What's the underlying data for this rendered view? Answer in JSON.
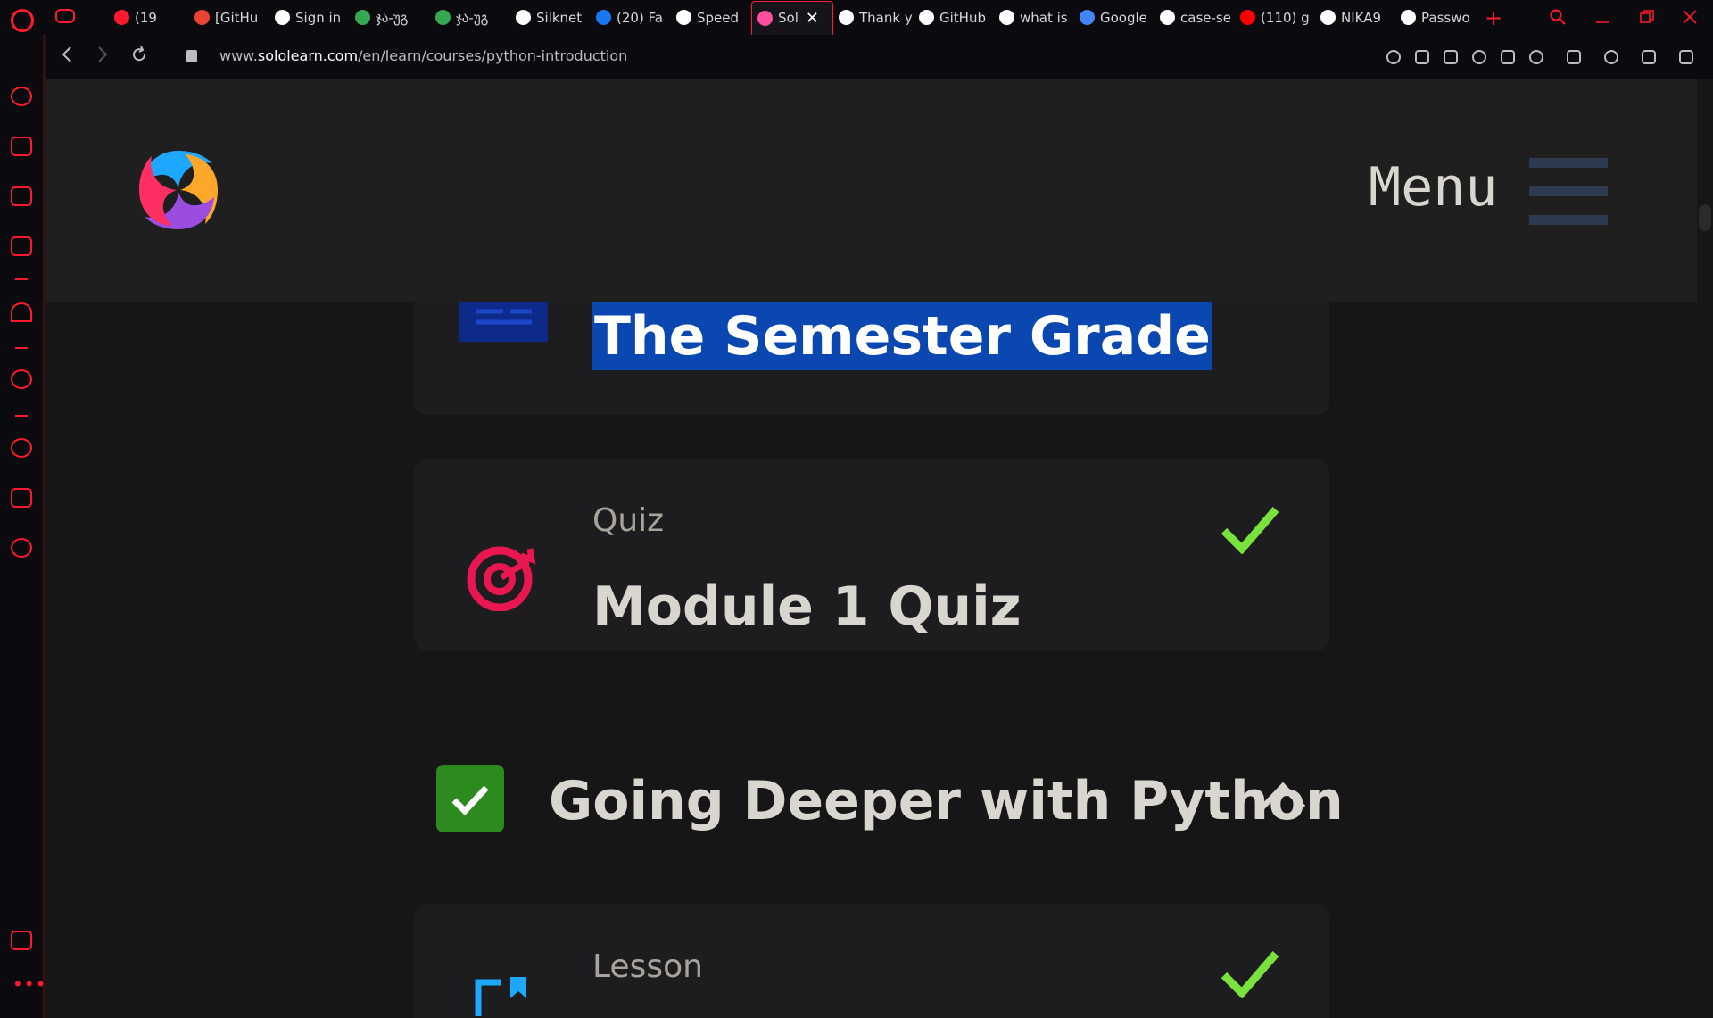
{
  "browser": {
    "tabs": [
      {
        "label": "(19",
        "icon": "speaker-icon",
        "color": "#ff1b2d"
      },
      {
        "label": "[GitHu",
        "icon": "gmail-icon",
        "color": "#ea4335"
      },
      {
        "label": "Sign in",
        "icon": "github-icon",
        "color": "#ffffff"
      },
      {
        "label": "ჯა-უგ",
        "icon": "google-drive-icon",
        "color": "#34a853"
      },
      {
        "label": "ჯა-უგ",
        "icon": "google-drive-icon",
        "color": "#34a853"
      },
      {
        "label": "Silknet",
        "icon": "globe-icon",
        "color": "#ffffff"
      },
      {
        "label": "(20) Fa",
        "icon": "facebook-icon",
        "color": "#1877f2"
      },
      {
        "label": "Speed",
        "icon": "speed-dial-icon",
        "color": "#ffffff"
      },
      {
        "label": "Sol",
        "icon": "sololearn-icon",
        "color": "#ff4f9e",
        "active": true
      },
      {
        "label": "Thank y",
        "icon": "globe-icon",
        "color": "#ffffff"
      },
      {
        "label": "GitHub",
        "icon": "github-icon",
        "color": "#ffffff"
      },
      {
        "label": "what is",
        "icon": "google-icon",
        "color": "#ffffff"
      },
      {
        "label": "Google",
        "icon": "google-translate-icon",
        "color": "#4285f4"
      },
      {
        "label": "case-se",
        "icon": "google-icon",
        "color": "#ffffff"
      },
      {
        "label": "(110) g",
        "icon": "youtube-icon",
        "color": "#ff0000"
      },
      {
        "label": "NIKA9",
        "icon": "github-icon",
        "color": "#ffffff"
      },
      {
        "label": "Passwo",
        "icon": "globe-icon",
        "color": "#ffffff"
      }
    ],
    "url_prefix": "www.",
    "url_domain": "sololearn.com",
    "url_path": "/en/learn/courses/python-introduction",
    "accent": "#ff1b2d"
  },
  "header": {
    "menu_label": "Menu"
  },
  "items": {
    "selected_title": "The Semester Grade",
    "quiz_type": "Quiz",
    "quiz_title": "Module 1 Quiz",
    "lesson_type": "Lesson"
  },
  "section": {
    "title": "Going Deeper with Python"
  },
  "colors": {
    "check_green": "#79e23c",
    "quiz_icon": "#e8174f",
    "section_check_bg": "#2d8a1f",
    "selection": "#0a47b0"
  }
}
